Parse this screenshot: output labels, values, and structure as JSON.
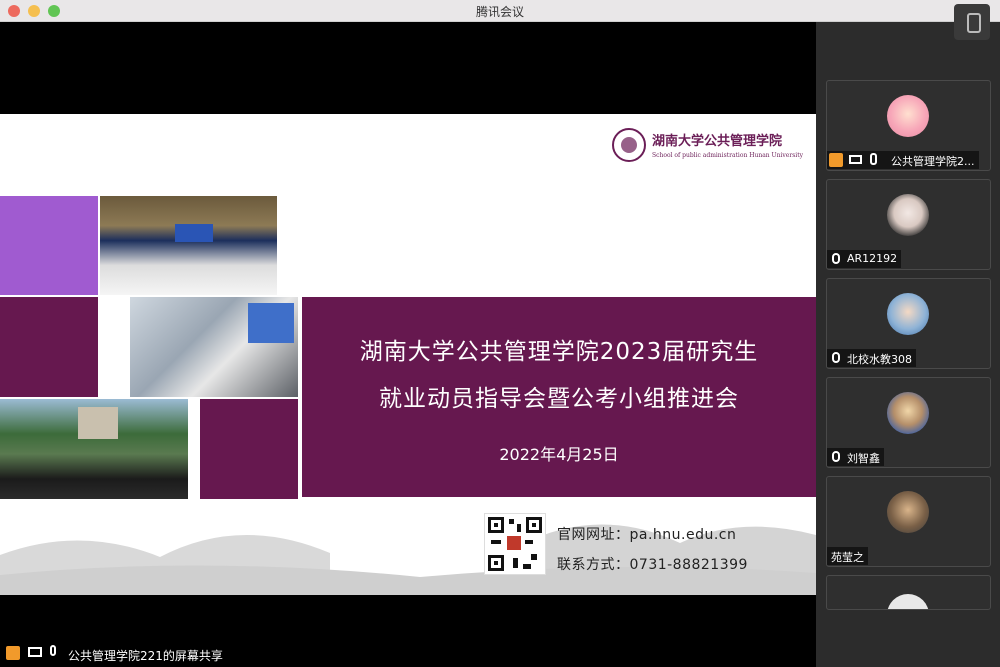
{
  "window": {
    "title": "腾讯会议"
  },
  "slide": {
    "school_name": "湖南大学公共管理学院",
    "school_english": "School of public administration Hunan University",
    "title_line1": "湖南大学公共管理学院2023届研究生",
    "title_line2": "就业动员指导会暨公考小组推进会",
    "date": "2022年4月25日",
    "website": "官网网址：pa.hnu.edu.cn",
    "phone": "联系方式：0731-88821399",
    "accent_color": "#66184f",
    "light_accent_color": "#a05bd0"
  },
  "share_bar": {
    "label": "公共管理学院221的屏幕共享"
  },
  "participants": [
    {
      "name": "公共管理学院2...",
      "icons": [
        "user-icon",
        "screen-share-icon",
        "mic-icon"
      ]
    },
    {
      "name": "AR12192",
      "icons": [
        "mic-off-icon"
      ]
    },
    {
      "name": "北校水教308",
      "icons": [
        "mic-off-icon"
      ]
    },
    {
      "name": "刘智鑫",
      "icons": [
        "mic-off-icon"
      ]
    },
    {
      "name": "苑莹之",
      "icons": []
    }
  ]
}
